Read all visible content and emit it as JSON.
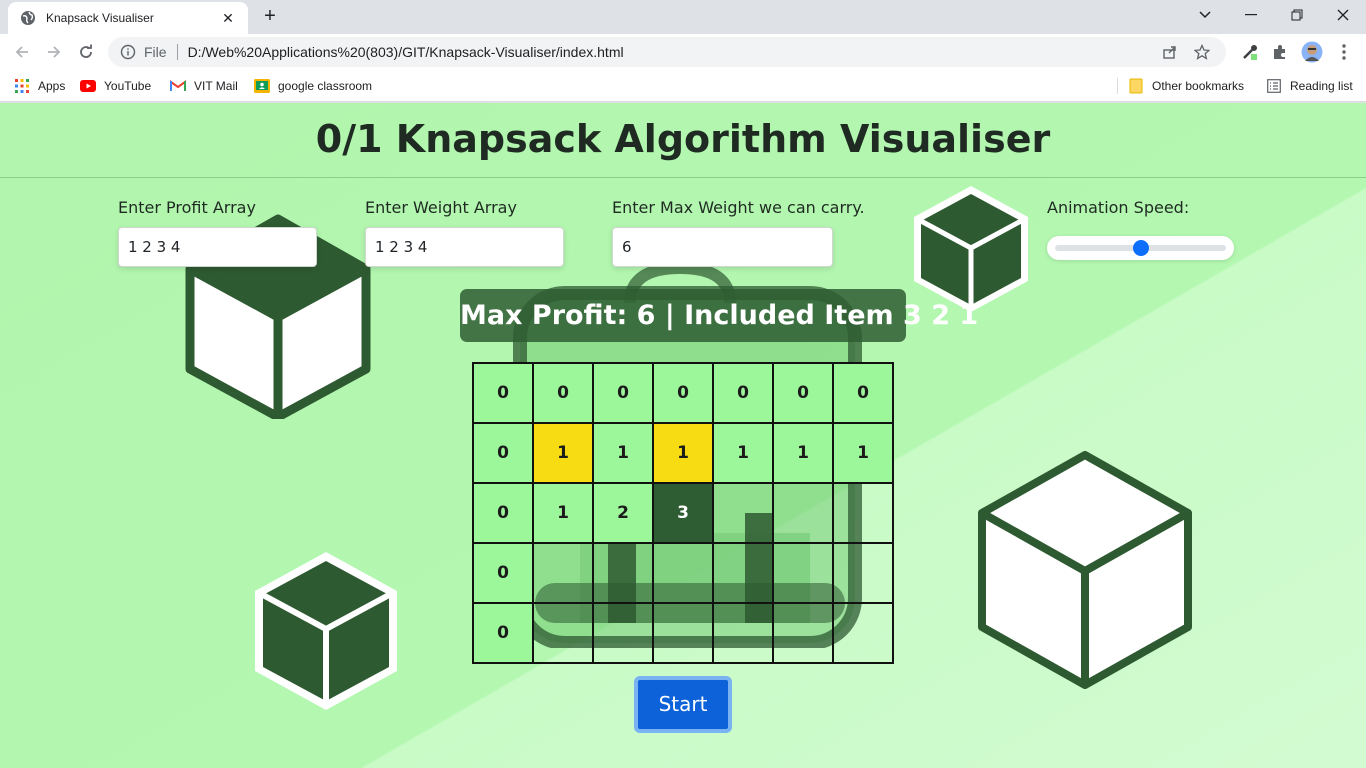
{
  "browser": {
    "tab_title": "Knapsack Visualiser",
    "new_tab_symbol": "+",
    "close_symbol": "✕",
    "omnibox_scheme": "File",
    "url": "D:/Web%20Applications%20(803)/GIT/Knapsack-Visualiser/index.html",
    "bookmarks": [
      {
        "label": "Apps",
        "icon": "apps-grid-icon"
      },
      {
        "label": "YouTube",
        "icon": "youtube-icon"
      },
      {
        "label": "VIT Mail",
        "icon": "gmail-icon"
      },
      {
        "label": "google classroom",
        "icon": "classroom-icon"
      }
    ],
    "other_bookmarks": "Other bookmarks",
    "reading_list": "Reading list"
  },
  "page": {
    "title": "0/1 Knapsack Algorithm Visualiser",
    "profit_label": "Enter Profit Array",
    "profit_value": "1 2 3 4",
    "weight_label": "Enter Weight Array",
    "weight_value": "1 2 3 4",
    "maxweight_label": "Enter Max Weight we can carry.",
    "maxweight_value": "6",
    "speed_label": "Animation Speed:",
    "speed_level": 0.5,
    "result_text": "Max Profit: 6 | Included Item 3 2 1",
    "start_label": "Start"
  },
  "dp_table": {
    "rows": [
      [
        {
          "v": "0",
          "s": "green"
        },
        {
          "v": "0",
          "s": "green"
        },
        {
          "v": "0",
          "s": "green"
        },
        {
          "v": "0",
          "s": "green"
        },
        {
          "v": "0",
          "s": "green"
        },
        {
          "v": "0",
          "s": "green"
        },
        {
          "v": "0",
          "s": "green"
        }
      ],
      [
        {
          "v": "0",
          "s": "green"
        },
        {
          "v": "1",
          "s": "yellow"
        },
        {
          "v": "1",
          "s": "green"
        },
        {
          "v": "1",
          "s": "yellow"
        },
        {
          "v": "1",
          "s": "green"
        },
        {
          "v": "1",
          "s": "green"
        },
        {
          "v": "1",
          "s": "green"
        }
      ],
      [
        {
          "v": "0",
          "s": "green"
        },
        {
          "v": "1",
          "s": "green"
        },
        {
          "v": "2",
          "s": "green"
        },
        {
          "v": "3",
          "s": "dark"
        },
        {
          "v": "",
          "s": "empty"
        },
        {
          "v": "",
          "s": "empty"
        },
        {
          "v": "",
          "s": "empty"
        }
      ],
      [
        {
          "v": "0",
          "s": "green"
        },
        {
          "v": "",
          "s": "empty"
        },
        {
          "v": "",
          "s": "empty"
        },
        {
          "v": "",
          "s": "empty"
        },
        {
          "v": "",
          "s": "empty"
        },
        {
          "v": "",
          "s": "empty"
        },
        {
          "v": "",
          "s": "empty"
        }
      ],
      [
        {
          "v": "0",
          "s": "green"
        },
        {
          "v": "",
          "s": "empty"
        },
        {
          "v": "",
          "s": "empty"
        },
        {
          "v": "",
          "s": "empty"
        },
        {
          "v": "",
          "s": "empty"
        },
        {
          "v": "",
          "s": "empty"
        },
        {
          "v": "",
          "s": "empty"
        }
      ]
    ]
  },
  "colors": {
    "green_cell": "#9cf79a",
    "yellow_cell": "#f7dc13",
    "dark_cell": "#2f5d33",
    "accent": "#0d62d9"
  }
}
